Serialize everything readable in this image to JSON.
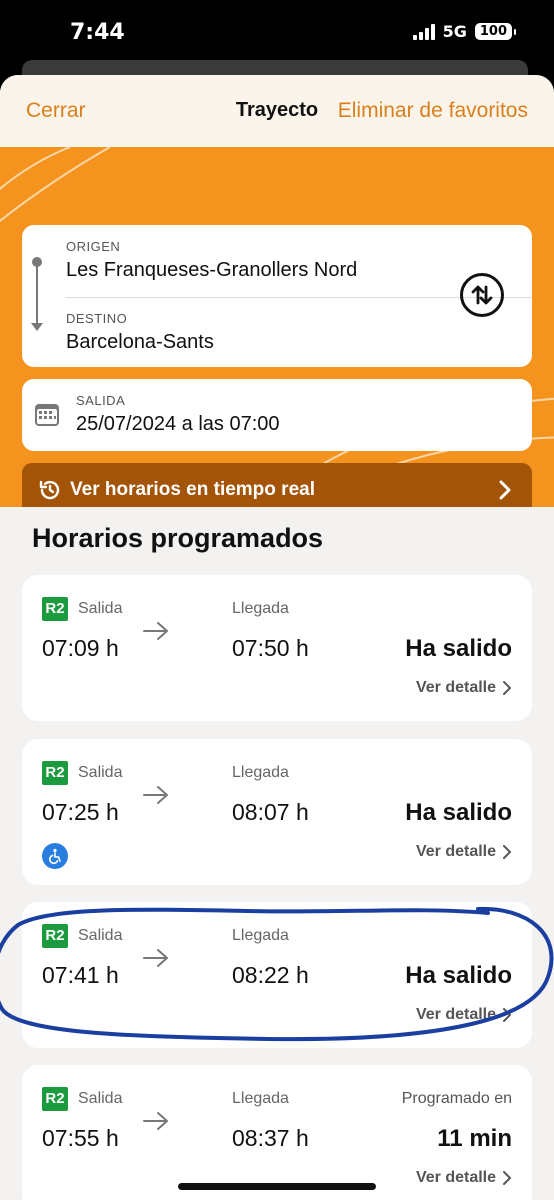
{
  "status_bar": {
    "time": "7:44",
    "network": "5G",
    "battery": "100"
  },
  "header": {
    "close": "Cerrar",
    "title": "Trayecto",
    "remove_favorites": "Eliminar de favoritos"
  },
  "route": {
    "origin_label": "ORIGEN",
    "origin": "Les Franqueses-Granollers Nord",
    "destination_label": "DESTINO",
    "destination": "Barcelona-Sants"
  },
  "departure": {
    "label": "SALIDA",
    "value": "25/07/2024 a las 07:00"
  },
  "realtime_button": "Ver horarios en tiempo real",
  "section_title": "Horarios programados",
  "colors": {
    "accent": "#f5931f",
    "dark_accent": "#a45407",
    "line_badge": "#1b9a3e",
    "highlight": "#1a3fa0"
  },
  "trains": [
    {
      "line": "R2",
      "dep_label": "Salida",
      "dep": "07:09 h",
      "arr_label": "Llegada",
      "arr": "07:50 h",
      "status": "Ha salido",
      "detail": "Ver detalle"
    },
    {
      "line": "R2",
      "dep_label": "Salida",
      "dep": "07:25 h",
      "arr_label": "Llegada",
      "arr": "08:07 h",
      "status": "Ha salido",
      "detail": "Ver detalle",
      "accessible_icon": "wheelchair-icon"
    },
    {
      "line": "R2",
      "dep_label": "Salida",
      "dep": "07:41 h",
      "arr_label": "Llegada",
      "arr": "08:22 h",
      "status": "Ha salido",
      "detail": "Ver detalle"
    },
    {
      "line": "R2",
      "dep_label": "Salida",
      "dep": "07:55 h",
      "arr_label": "Llegada",
      "arr": "08:37 h",
      "status_label": "Programado en",
      "status": "11 min",
      "detail": "Ver detalle"
    }
  ]
}
